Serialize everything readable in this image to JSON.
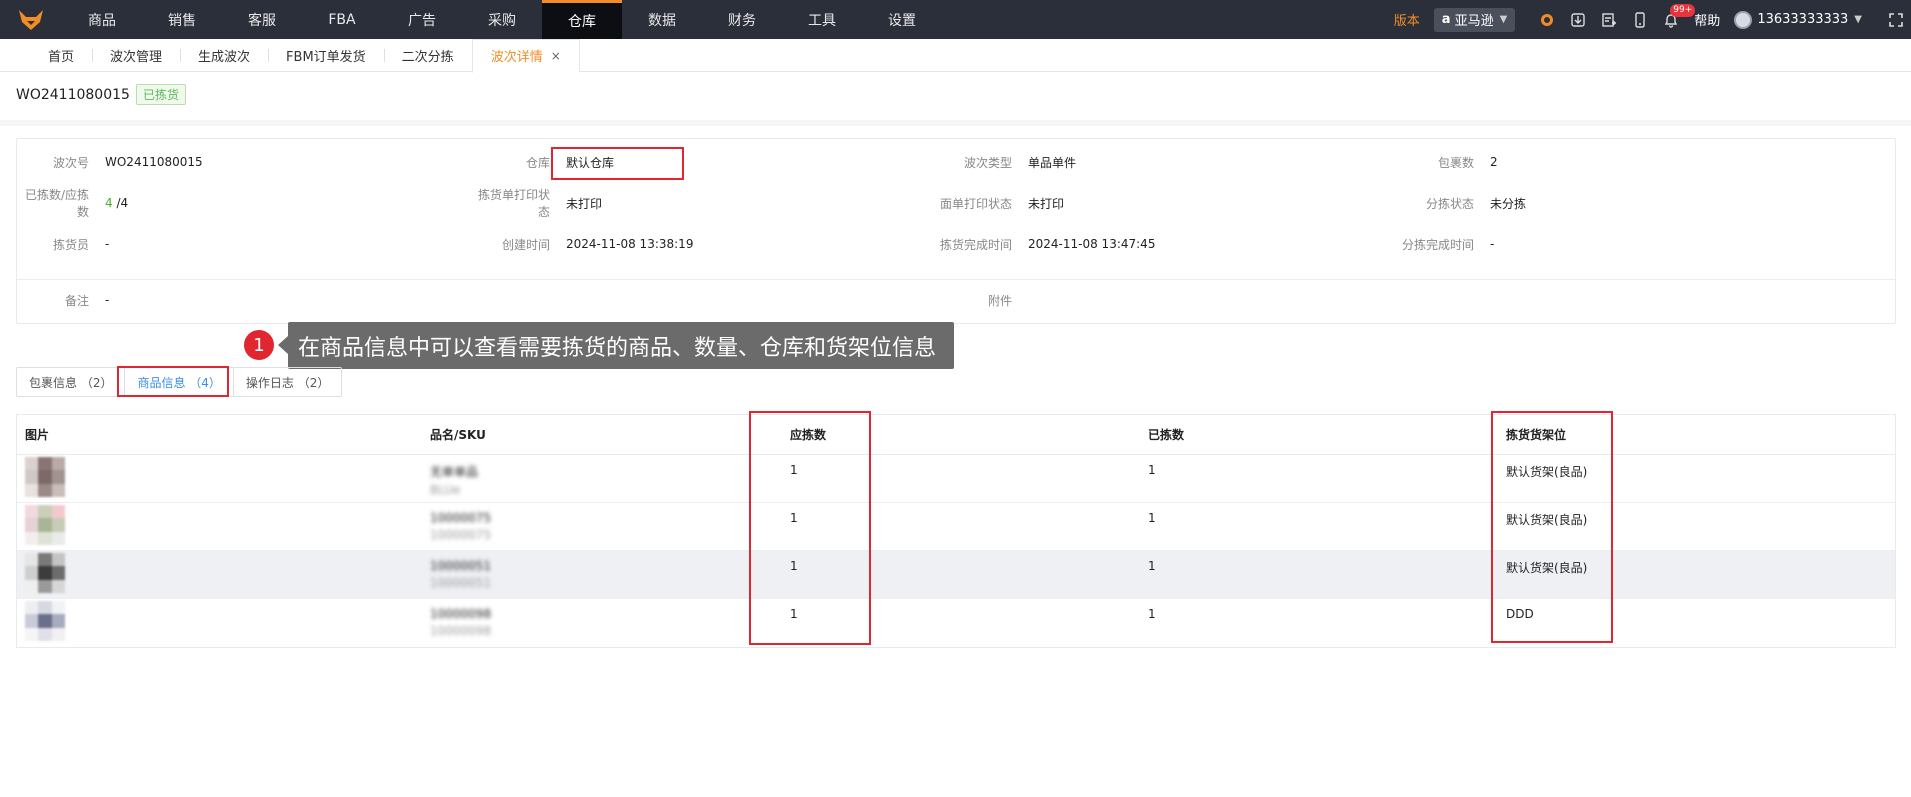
{
  "topnav": {
    "items": [
      "商品",
      "销售",
      "客服",
      "FBA",
      "广告",
      "采购",
      "仓库",
      "数据",
      "财务",
      "工具",
      "设置"
    ],
    "active": "仓库",
    "version": "版本",
    "store": "亚马逊",
    "notification_badge": "99+",
    "help": "帮助",
    "user": "13633333333"
  },
  "tabs": {
    "items": [
      "首页",
      "波次管理",
      "生成波次",
      "FBM订单发货",
      "二次分拣",
      "波次详情"
    ],
    "close": "×"
  },
  "header": {
    "wave_no": "WO2411080015",
    "status": "已拣货"
  },
  "info": {
    "wave_no_label": "波次号",
    "wave_no": "WO2411080015",
    "warehouse_label": "仓库",
    "warehouse": "默认仓库",
    "wave_type_label": "波次类型",
    "wave_type": "单品单件",
    "package_count_label": "包裹数",
    "package_count": "2",
    "picked_label": "已拣数/应拣数",
    "picked": "4",
    "should_pick": "/4",
    "pick_print_label": "拣货单打印状态",
    "pick_print": "未打印",
    "face_print_label": "面单打印状态",
    "face_print": "未打印",
    "sort_status_label": "分拣状态",
    "sort_status": "未分拣",
    "picker_label": "拣货员",
    "picker": "-",
    "created_label": "创建时间",
    "created": "2024-11-08 13:38:19",
    "pick_done_label": "拣货完成时间",
    "pick_done": "2024-11-08 13:47:45",
    "sort_done_label": "分拣完成时间",
    "sort_done": "-",
    "remark_label": "备注",
    "remark": "-",
    "attachment_label": "附件"
  },
  "callout": {
    "step": "1",
    "text": "在商品信息中可以查看需要拣货的商品、数量、仓库和货架位信息"
  },
  "segments": [
    "包裹信息 （2）",
    "商品信息 （4）",
    "操作日志 （2）"
  ],
  "table": {
    "headers": [
      "图片",
      "品名/SKU",
      "应拣数",
      "已拣数",
      "拣货货架位"
    ],
    "rows": [
      {
        "name": "无单单品",
        "sku": "BLUe",
        "should": "1",
        "picked": "1",
        "shelf": "默认货架(良品)"
      },
      {
        "name": "10000075",
        "sku": "10000075",
        "should": "1",
        "picked": "1",
        "shelf": "默认货架(良品)"
      },
      {
        "name": "10000051",
        "sku": "10000051",
        "should": "1",
        "picked": "1",
        "shelf": "默认货架(良品)"
      },
      {
        "name": "10000098",
        "sku": "10000098",
        "should": "1",
        "picked": "1",
        "shelf": "DDD"
      }
    ]
  },
  "colors": {
    "accent": "#f28c28",
    "topbar": "#2b2f3a",
    "highlight_red": "#e0262f",
    "link_blue": "#3a8ee6",
    "success_green": "#46b12c"
  }
}
